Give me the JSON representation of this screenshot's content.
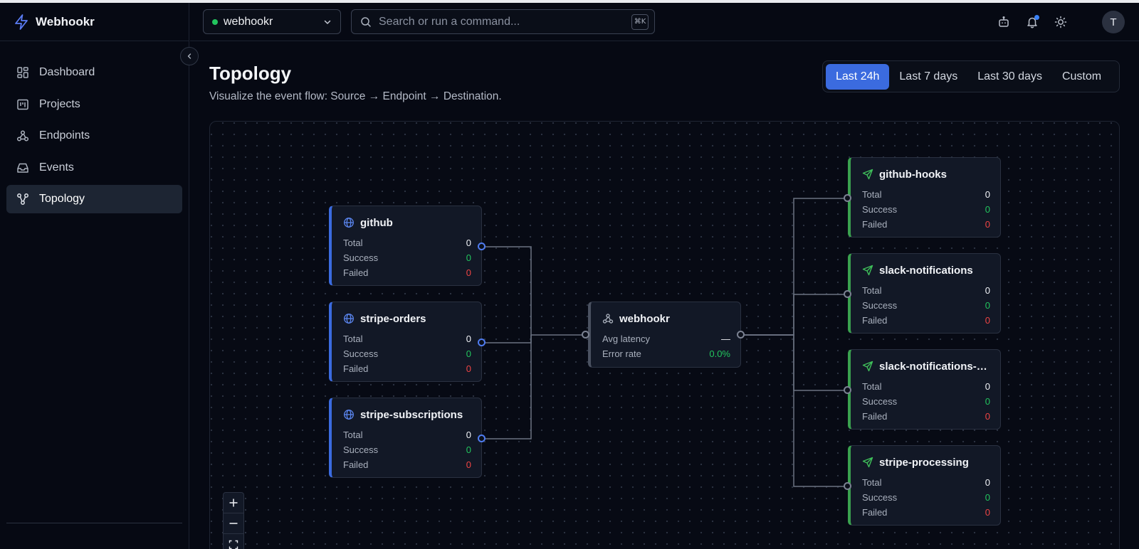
{
  "app": {
    "name": "Webhookr"
  },
  "header": {
    "project": "webhookr",
    "search_placeholder": "Search or run a command...",
    "kbd_hint": "⌘K",
    "avatar_initial": "T"
  },
  "sidebar": {
    "items": [
      {
        "label": "Dashboard",
        "icon": "dashboard-icon",
        "active": false
      },
      {
        "label": "Projects",
        "icon": "projects-icon",
        "active": false
      },
      {
        "label": "Endpoints",
        "icon": "webhook-icon",
        "active": false
      },
      {
        "label": "Events",
        "icon": "inbox-icon",
        "active": false
      },
      {
        "label": "Topology",
        "icon": "topology-icon",
        "active": true
      }
    ]
  },
  "page": {
    "title": "Topology",
    "subtitle": "Visualize the event flow: Source → Endpoint → Destination."
  },
  "time_ranges": {
    "options": [
      "Last 24h",
      "Last 7 days",
      "Last 30 days",
      "Custom"
    ],
    "selected": "Last 24h"
  },
  "labels": {
    "total": "Total",
    "success": "Success",
    "failed": "Failed"
  },
  "sources": [
    {
      "name": "github",
      "total": "0",
      "success": "0",
      "failed": "0"
    },
    {
      "name": "stripe-orders",
      "total": "0",
      "success": "0",
      "failed": "0"
    },
    {
      "name": "stripe-subscriptions",
      "total": "0",
      "success": "0",
      "failed": "0"
    }
  ],
  "endpoint": {
    "name": "webhookr",
    "avg_latency_label": "Avg latency",
    "avg_latency": "—",
    "error_rate_label": "Error rate",
    "error_rate": "0.0%"
  },
  "destinations": [
    {
      "name": "github-hooks",
      "total": "0",
      "success": "0",
      "failed": "0"
    },
    {
      "name": "slack-notifications",
      "total": "0",
      "success": "0",
      "failed": "0"
    },
    {
      "name": "slack-notifications-m...",
      "total": "0",
      "success": "0",
      "failed": "0"
    },
    {
      "name": "stripe-processing",
      "total": "0",
      "success": "0",
      "failed": "0"
    }
  ],
  "colors": {
    "accent": "#3b6bdf",
    "success": "#22c55e",
    "failed": "#ef4444",
    "source_bar": "#3b6bdf",
    "destination_bar": "#3aa14f"
  }
}
